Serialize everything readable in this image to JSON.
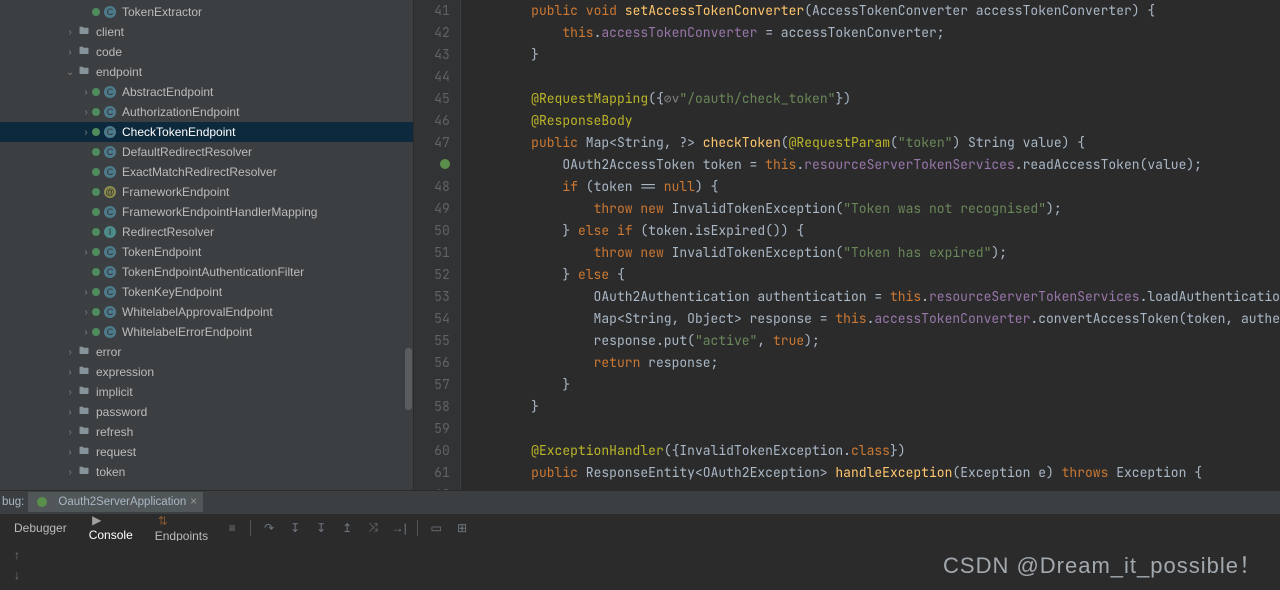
{
  "tree": [
    {
      "depth": 5,
      "arrow": "",
      "icon": "class",
      "label": "TokenExtractor"
    },
    {
      "depth": 4,
      "arrow": "›",
      "icon": "folder",
      "label": "client"
    },
    {
      "depth": 4,
      "arrow": "›",
      "icon": "folder",
      "label": "code"
    },
    {
      "depth": 4,
      "arrow": "⌄",
      "icon": "folder",
      "label": "endpoint"
    },
    {
      "depth": 5,
      "arrow": "›",
      "icon": "class",
      "label": "AbstractEndpoint"
    },
    {
      "depth": 5,
      "arrow": "›",
      "icon": "class",
      "label": "AuthorizationEndpoint"
    },
    {
      "depth": 5,
      "arrow": "›",
      "icon": "class",
      "label": "CheckTokenEndpoint",
      "selected": true
    },
    {
      "depth": 5,
      "arrow": "",
      "icon": "class",
      "label": "DefaultRedirectResolver"
    },
    {
      "depth": 5,
      "arrow": "",
      "icon": "class",
      "label": "ExactMatchRedirectResolver"
    },
    {
      "depth": 5,
      "arrow": "",
      "icon": "ann",
      "label": "FrameworkEndpoint"
    },
    {
      "depth": 5,
      "arrow": "",
      "icon": "class",
      "label": "FrameworkEndpointHandlerMapping"
    },
    {
      "depth": 5,
      "arrow": "",
      "icon": "iface",
      "label": "RedirectResolver"
    },
    {
      "depth": 5,
      "arrow": "›",
      "icon": "class",
      "label": "TokenEndpoint"
    },
    {
      "depth": 5,
      "arrow": "",
      "icon": "class",
      "label": "TokenEndpointAuthenticationFilter"
    },
    {
      "depth": 5,
      "arrow": "›",
      "icon": "class",
      "label": "TokenKeyEndpoint"
    },
    {
      "depth": 5,
      "arrow": "›",
      "icon": "class",
      "label": "WhitelabelApprovalEndpoint"
    },
    {
      "depth": 5,
      "arrow": "›",
      "icon": "class",
      "label": "WhitelabelErrorEndpoint"
    },
    {
      "depth": 4,
      "arrow": "›",
      "icon": "folder",
      "label": "error"
    },
    {
      "depth": 4,
      "arrow": "›",
      "icon": "folder",
      "label": "expression"
    },
    {
      "depth": 4,
      "arrow": "›",
      "icon": "folder",
      "label": "implicit"
    },
    {
      "depth": 4,
      "arrow": "›",
      "icon": "folder",
      "label": "password"
    },
    {
      "depth": 4,
      "arrow": "›",
      "icon": "folder",
      "label": "refresh"
    },
    {
      "depth": 4,
      "arrow": "›",
      "icon": "folder",
      "label": "request"
    },
    {
      "depth": 4,
      "arrow": "›",
      "icon": "folder",
      "label": "token"
    }
  ],
  "gutter_start": 41,
  "code_lines": [
    "        <span class='kw'>public</span> <span class='kw'>void</span> <span class='mname'>setAccessTokenConverter</span>(AccessTokenConverter accessTokenConverter) {",
    "            <span class='kw'>this</span>.<span class='field'>accessTokenConverter</span> = accessTokenConverter;",
    "        }",
    "",
    "        <span class='ann'>@RequestMapping</span>({<span class='comment'>⊘∨</span><span class='str'>\"/oauth/check_token\"</span>})",
    "        <span class='ann'>@ResponseBody</span>",
    "        <span class='kw'>public</span> Map&lt;String, ?&gt; <span class='mname'>checkToken</span>(<span class='ann'>@RequestParam</span>(<span class='str'>\"token\"</span>) String value) {",
    "            OAuth2AccessToken token = <span class='kw'>this</span>.<span class='field'>resourceServerTokenServices</span>.readAccessToken(value);",
    "            <span class='kw'>if</span> (token == <span class='kw'>null</span>) {",
    "                <span class='kw'>throw</span> <span class='kw'>new</span> InvalidTokenException(<span class='str'>\"Token was not recognised\"</span>);",
    "            } <span class='kw'>else</span> <span class='kw'>if</span> (token.isExpired()) {",
    "                <span class='kw'>throw</span> <span class='kw'>new</span> InvalidTokenException(<span class='str'>\"Token has expired\"</span>);",
    "            } <span class='kw'>else</span> {",
    "                OAuth2Authentication authentication = <span class='kw'>this</span>.<span class='field'>resourceServerTokenServices</span>.loadAuthenticatio",
    "                Map&lt;String, Object&gt; response = <span class='kw'>this</span>.<span class='field'>accessTokenConverter</span>.convertAccessToken(token, authe",
    "                response.put(<span class='str'>\"active\"</span>, <span class='kw'>true</span>);",
    "                <span class='kw'>return</span> response;",
    "            }",
    "        }",
    "",
    "        <span class='ann'>@ExceptionHandler</span>({InvalidTokenException.<span class='kw'>class</span>})",
    "        <span class='kw'>public</span> ResponseEntity&lt;OAuth2Exception&gt; <span class='mname'>handleException</span>(Exception e) <span class='kw'>throws</span> Exception {"
  ],
  "badge_line": 47,
  "run": {
    "prefix": "bug:",
    "app": "Oauth2ServerApplication"
  },
  "dbg_tabs": {
    "debugger": "Debugger",
    "console": "Console",
    "endpoints": "Endpoints"
  },
  "watermark": "CSDN @Dream_it_possible！"
}
